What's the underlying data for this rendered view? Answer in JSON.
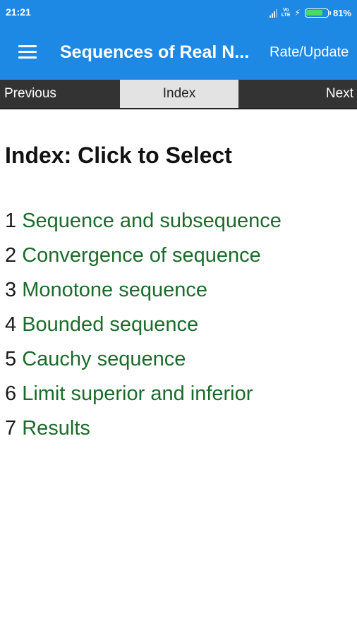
{
  "status_bar": {
    "time": "21:21",
    "volte_line1": "Vo",
    "volte_line2": "LTE",
    "battery_level": 0.81,
    "battery_percent": "81%",
    "battery_color": "#4cd964"
  },
  "app_bar": {
    "background_color": "#1e88e5",
    "menu_icon": "hamburger-icon",
    "title": "Sequences of Real N...",
    "rate_update_label": "Rate/Update"
  },
  "nav": {
    "previous_label": "Previous",
    "index_label": "Index",
    "next_label": "Next"
  },
  "content": {
    "heading": "Index: Click to Select",
    "items": [
      {
        "number": "1",
        "label": "Sequence and subsequence"
      },
      {
        "number": "2",
        "label": "Convergence of sequence"
      },
      {
        "number": "3",
        "label": "Monotone sequence"
      },
      {
        "number": "4",
        "label": "Bounded sequence"
      },
      {
        "number": "5",
        "label": "Cauchy sequence"
      },
      {
        "number": "6",
        "label": "Limit superior and inferior"
      },
      {
        "number": "7",
        "label": "Results"
      }
    ],
    "link_color": "#1b6b2a"
  }
}
